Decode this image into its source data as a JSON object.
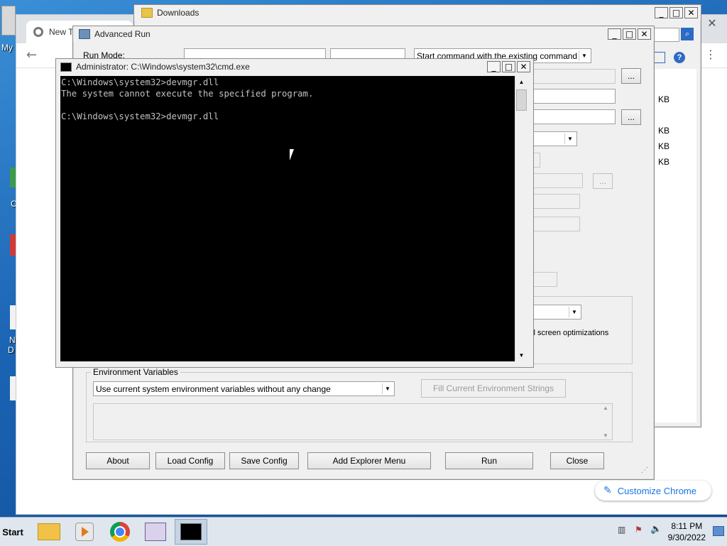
{
  "desktop": {
    "icon_labels": [
      "My",
      "C",
      "N",
      "D"
    ]
  },
  "chrome": {
    "tab_title": "New T",
    "customize_label": "Customize Chrome"
  },
  "downloads": {
    "title": "Downloads",
    "file_sizes": [
      "KB",
      "KB",
      "KB",
      "KB"
    ]
  },
  "advanced_run": {
    "title": "Advanced Run",
    "run_mode_label": "Run Mode:",
    "command_option": "Start command with the existing command",
    "full_screen_label": "ll screen optimizations",
    "env_group_label": "Environment Variables",
    "env_select_value": "Use current system environment variables without any change",
    "fill_env_button": "Fill Current Environment Strings",
    "buttons": {
      "about": "About",
      "load_config": "Load Config",
      "save_config": "Save Config",
      "add_explorer_menu": "Add Explorer Menu",
      "run": "Run",
      "close": "Close"
    },
    "browse_label": "..."
  },
  "cmd": {
    "title": "Administrator: C:\\Windows\\system32\\cmd.exe",
    "lines": [
      "C:\\Windows\\system32>devmgr.dll",
      "The system cannot execute the specified program.",
      "",
      "C:\\Windows\\system32>devmgr.dll"
    ]
  },
  "taskbar": {
    "start_label": "Start",
    "time": "8:11 PM",
    "date": "9/30/2022"
  },
  "colors": {
    "desktop_blue": "#1b64b4",
    "chrome_accent": "#1a73e8",
    "cmd_bg": "#000000",
    "cmd_fg": "#c0c0c0"
  }
}
